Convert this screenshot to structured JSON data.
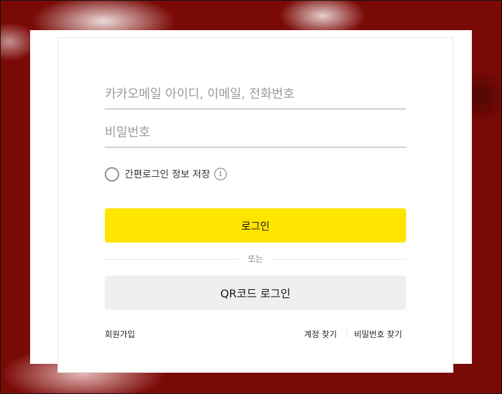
{
  "login": {
    "id_placeholder": "카카오메일 아이디, 이메일, 전화번호",
    "password_placeholder": "비밀번호",
    "keep_login_label": "간편로그인 정보 저장",
    "info_glyph": "i",
    "login_button": "로그인",
    "divider_text": "또는",
    "qr_button": "QR코드 로그인",
    "signup_link": "회원가입",
    "find_account_link": "계정 찾기",
    "find_password_link": "비밀번호 찾기"
  },
  "colors": {
    "login_button": "#fee500",
    "qr_button": "#efefef",
    "background": "#7a0a06"
  }
}
